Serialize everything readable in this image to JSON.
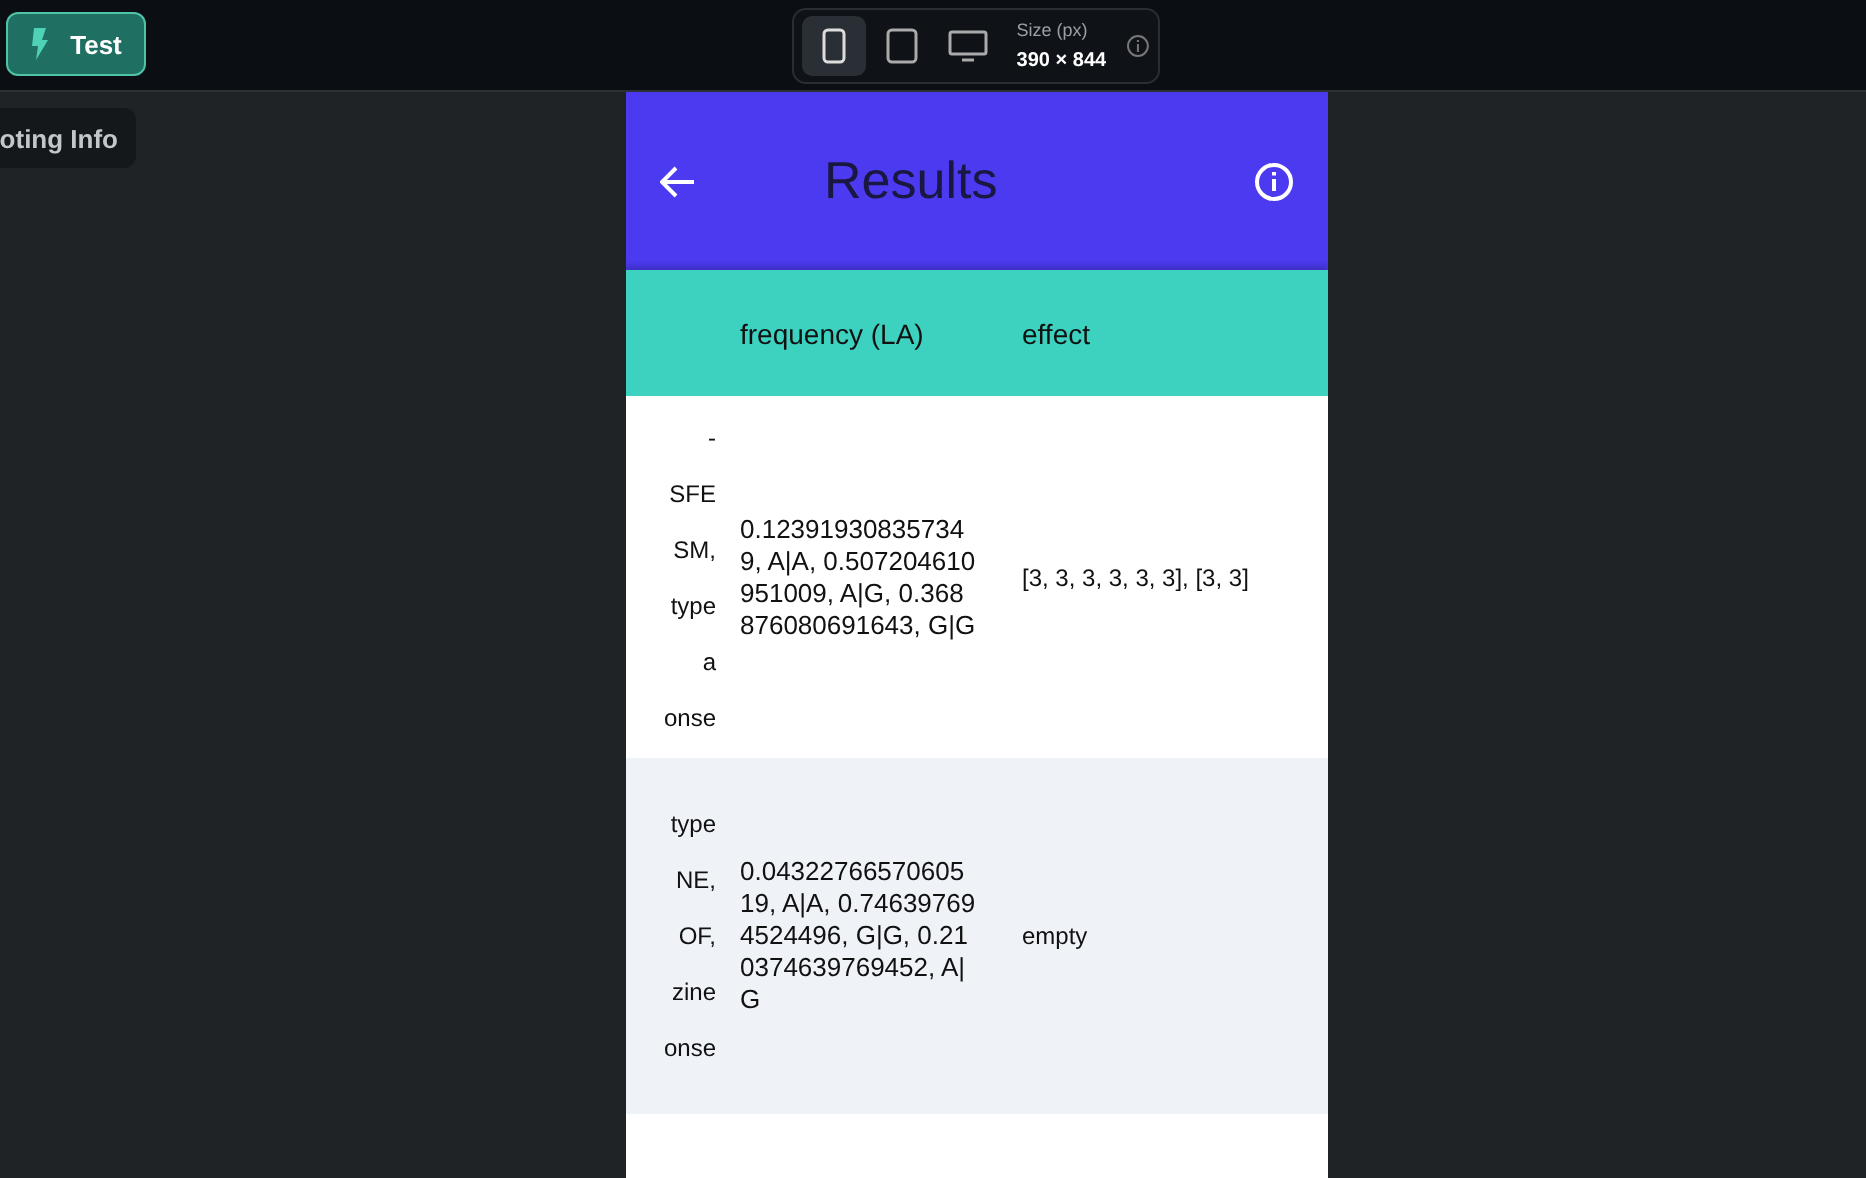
{
  "toolbar": {
    "test_button": "Test",
    "devices": [
      {
        "kind": "phone",
        "selected": true
      },
      {
        "kind": "tablet",
        "selected": false
      },
      {
        "kind": "desktop",
        "selected": false
      }
    ],
    "size_label": "Size (px)",
    "size_value": "390 × 844"
  },
  "side_tab": "oting Info",
  "app_bar": {
    "title": "Results"
  },
  "table": {
    "columns": [
      "frequency (LA)",
      "effect"
    ],
    "rows": [
      {
        "column_1": [
          "-",
          "SFE",
          "SM,",
          "type",
          "a",
          "onse"
        ],
        "frequency": "0.123919308357349, A|A, 0.507204610951009, A|G, 0.368876080691643, G|G",
        "effect": "[3, 3, 3, 3, 3, 3], [3, 3]"
      },
      {
        "column_1": [
          "type",
          "NE,",
          "OF,",
          "zine",
          "onse"
        ],
        "frequency": "0.0432276657060519, A|A, 0.746397694524496, G|G, 0.210374639769452, A|G",
        "effect": "empty"
      }
    ]
  }
}
